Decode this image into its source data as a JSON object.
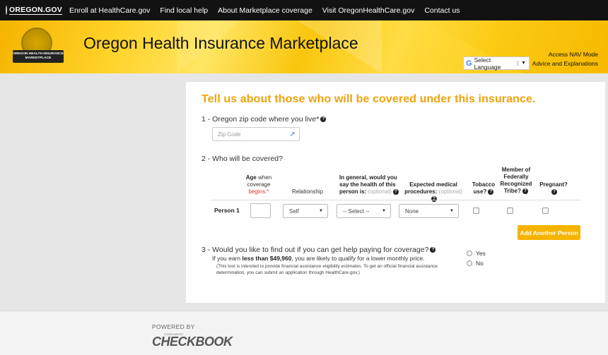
{
  "topnav": {
    "logo_text": "OREGON.GOV",
    "links": [
      "Enroll at HealthCare.gov",
      "Find local help",
      "About Marketplace coverage",
      "Visit OregonHealthCare.gov",
      "Contact us"
    ]
  },
  "banner": {
    "seal_label": "OREGON HEALTH INSURANCE MARKETPLACE",
    "title": "Oregon Health Insurance Marketplace",
    "access_nav": "Access NAV Mode",
    "language_select": "Select Language",
    "advice": "Advice and Explanations"
  },
  "form": {
    "heading": "Tell us about those who will be covered under this insurance.",
    "q1": "1 - Oregon zip code where you live*",
    "zip_placeholder": "Zip Code",
    "q2": "2 - Who will be covered?",
    "columns": {
      "age_b": "Age",
      "age_rest": " when coverage",
      "age_req": "begins:*",
      "relationship": "Relationship",
      "health_a": "In general, would you say the health of this person is:",
      "health_opt": "(optional)",
      "procedures_a": "Expected medical procedures:",
      "procedures_opt": "(optional)",
      "tobacco": "Tobacco use?",
      "tribe": "Member of Federally Recognized Tribe?",
      "pregnant": "Pregnant?"
    },
    "person_label": "Person 1",
    "relationship_value": "Self",
    "health_value": "-- Select --",
    "procedures_value": "None",
    "add_person": "Add Another Person",
    "q3": "3 - Would you like to find out if you can get help paying for coverage?",
    "earn_pre": "If you earn ",
    "earn_bold": "less than $49,960",
    "earn_post": ", you are likely to qualify for a lower monthly price.",
    "disclaimer": "(This tool is intended to provide financial assistance eligibility estimates. To get an official financial assistance determination, you can submit an application through HealthCare.gov.)",
    "yes": "Yes",
    "no": "No"
  },
  "footer": {
    "powered_by": "POWERED BY",
    "consumers": "CONSUMERS'",
    "checkbook": "CHECKBOOK"
  }
}
